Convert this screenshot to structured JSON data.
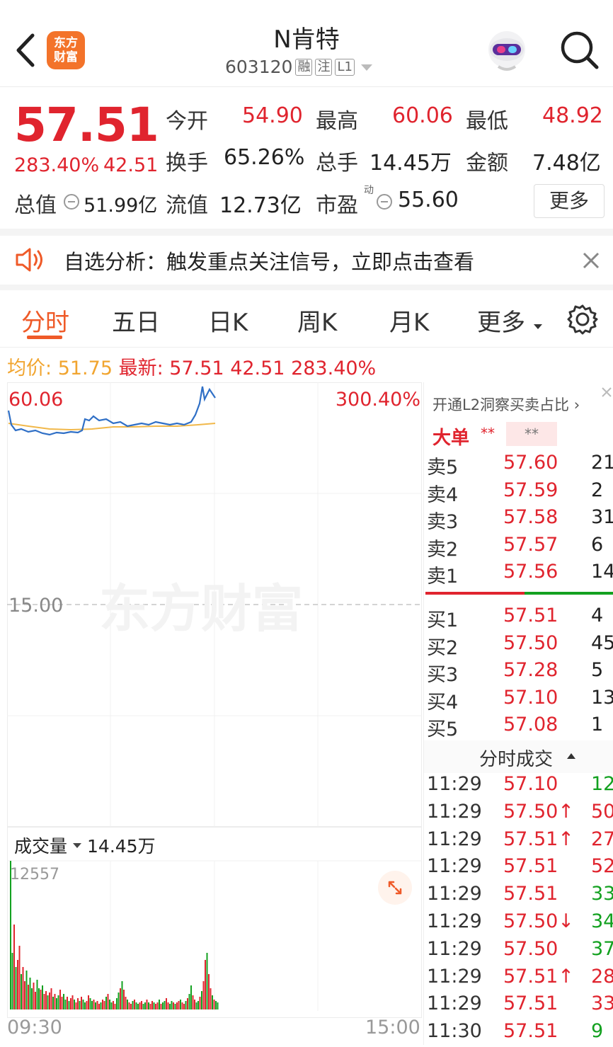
{
  "header": {
    "title": "N肯特",
    "code": "603120",
    "tags": [
      "融",
      "注",
      "L1"
    ],
    "logo_line1": "东方",
    "logo_line2": "财富"
  },
  "quote": {
    "price": "57.51",
    "change_pct": "283.40%",
    "change_amt": "42.51",
    "open_label": "今开",
    "open": "54.90",
    "high_label": "最高",
    "high": "60.06",
    "low_label": "最低",
    "low": "48.92",
    "turnover_label": "换手",
    "turnover": "65.26%",
    "volume_label": "总手",
    "volume": "14.45万",
    "amount_label": "金额",
    "amount": "7.48亿",
    "mktcap_label": "总值",
    "mktcap": "51.99亿",
    "float_label": "流值",
    "float": "12.73亿",
    "pe_label": "市盈",
    "pe_sup": "动",
    "pe": "55.60",
    "more": "更多"
  },
  "banner": {
    "text": "自选分析：触发重点关注信号，立即点击查看"
  },
  "tabs": [
    "分时",
    "五日",
    "日K",
    "周K",
    "月K",
    "更多"
  ],
  "avg_bar": {
    "avg_label": "均价:",
    "avg_value": "51.75",
    "latest_label": "最新:",
    "latest_value": "57.51",
    "change_amt": "42.51",
    "change_pct": "283.40%"
  },
  "chart": {
    "top_price": "60.06",
    "top_pct": "300.40%",
    "ref_price": "15.00",
    "watermark": "东方财富",
    "volume_label": "成交量",
    "volume_total": "14.45万",
    "vol_max": "12557",
    "time_start": "09:30",
    "time_end": "15:00"
  },
  "book": {
    "l2_link": "开通L2洞察买卖占比",
    "big_order_label": "大单",
    "big_order_v1": "**",
    "big_order_v2": "**",
    "asks": [
      {
        "label": "卖5",
        "price": "57.60",
        "vol": "21"
      },
      {
        "label": "卖4",
        "price": "57.59",
        "vol": "2"
      },
      {
        "label": "卖3",
        "price": "57.58",
        "vol": "31"
      },
      {
        "label": "卖2",
        "price": "57.57",
        "vol": "6"
      },
      {
        "label": "卖1",
        "price": "57.56",
        "vol": "14"
      }
    ],
    "bids": [
      {
        "label": "买1",
        "price": "57.51",
        "vol": "4"
      },
      {
        "label": "买2",
        "price": "57.50",
        "vol": "45"
      },
      {
        "label": "买3",
        "price": "57.28",
        "vol": "5"
      },
      {
        "label": "买4",
        "price": "57.10",
        "vol": "13"
      },
      {
        "label": "买5",
        "price": "57.08",
        "vol": "1"
      }
    ],
    "ticks_title": "分时成交",
    "ticks": [
      {
        "time": "11:29",
        "price": "57.10",
        "vol": "12",
        "dir": "green"
      },
      {
        "time": "11:29",
        "price": "57.50↑",
        "vol": "50",
        "dir": "red"
      },
      {
        "time": "11:29",
        "price": "57.51↑",
        "vol": "27",
        "dir": "red"
      },
      {
        "time": "11:29",
        "price": "57.51",
        "vol": "52",
        "dir": "red"
      },
      {
        "time": "11:29",
        "price": "57.51",
        "vol": "33",
        "dir": "green"
      },
      {
        "time": "11:29",
        "price": "57.50↓",
        "vol": "34",
        "dir": "green"
      },
      {
        "time": "11:29",
        "price": "57.50",
        "vol": "37",
        "dir": "green"
      },
      {
        "time": "11:29",
        "price": "57.51↑",
        "vol": "28",
        "dir": "red"
      },
      {
        "time": "11:29",
        "price": "57.51",
        "vol": "33",
        "dir": "red"
      },
      {
        "time": "11:30",
        "price": "57.51",
        "vol": "9",
        "dir": "green"
      }
    ]
  },
  "colors": {
    "up": "#e0242e",
    "down": "#13a120",
    "accent": "#ef5a28",
    "price_line": "#2f6fc6",
    "avg_line": "#f1b84a"
  }
}
